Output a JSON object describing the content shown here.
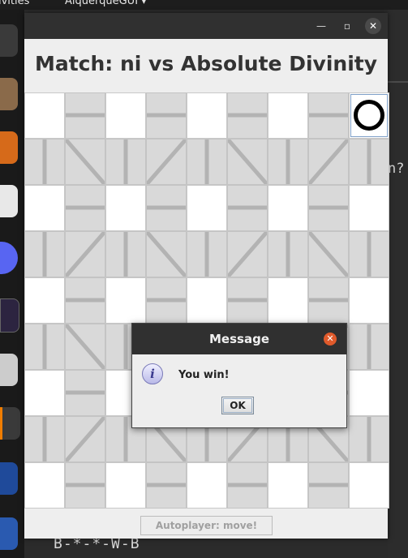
{
  "topbar": {
    "activities": "ivities",
    "app_menu": "AlquerqueGUI ▾"
  },
  "terminal": {
    "partial_text": "n?",
    "bottom_line": "B-*-*-W-B"
  },
  "window": {
    "title": "Match: ni vs Absolute Divinity",
    "minimize_icon": "minimize-icon",
    "maximize_icon": "maximize-icon",
    "close_icon": "close-icon",
    "autoplayer_label": "Autoplayer: move!"
  },
  "board": {
    "size": 5,
    "pieces": [
      {
        "row": 0,
        "col": 4,
        "type": "O"
      }
    ]
  },
  "dialog": {
    "title": "Message",
    "message": "You win!",
    "ok_label": "OK",
    "icon": "info-icon"
  },
  "colors": {
    "dialog_close": "#e05a2b",
    "board_link": "#b3b3b3",
    "node": "#ffffff"
  }
}
